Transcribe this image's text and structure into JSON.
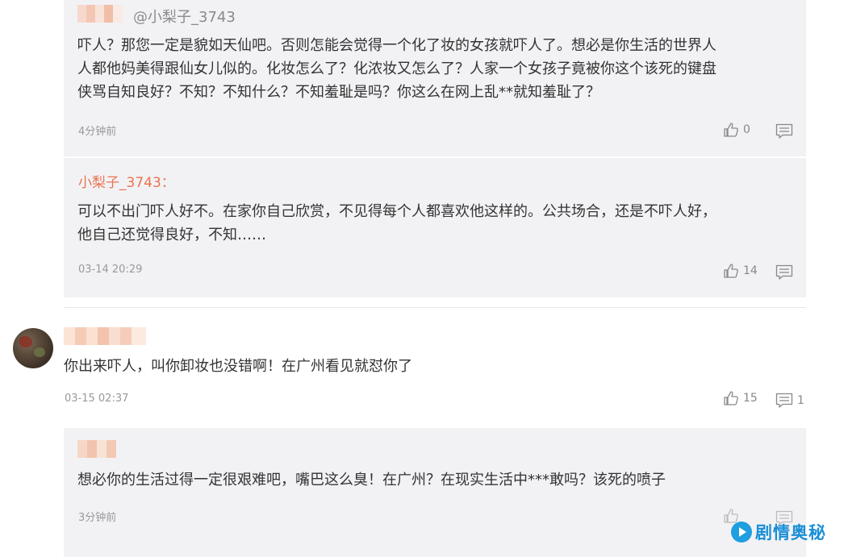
{
  "thread": {
    "replies_top": [
      {
        "handle": "@小梨子_3743",
        "text": "吓人？那您一定是貌如天仙吧。否则怎能会觉得一个化了妆的女孩就吓人了。想必是你生活的世界人\n人都他妈美得跟仙女儿似的。化妆怎么了？化浓妆又怎么了？人家一个女孩子竟被你这个该死的键盘\n侠骂自知良好？不知？不知什么？不知羞耻是吗？你这么在网上乱**就知羞耻了？",
        "time": "4分钟前",
        "likes": "0"
      },
      {
        "author": "小梨子_3743：",
        "text": "可以不出门吓人好不。在家你自己欣赏，不见得每个人都喜欢他这样的。公共场合，还是不吓人好，\n他自己还觉得良好，不知……",
        "time": "03-14 20:29",
        "likes": "14"
      }
    ],
    "comment": {
      "text": "你出来吓人，叫你卸妆也没错啊！在广州看见就怼你了",
      "time": "03-15 02:37",
      "likes": "15",
      "replies_count": "1"
    },
    "reply_bottom": {
      "text": "想必你的生活过得一定很艰难吧，嘴巴这么臭！在广州？在现实生活中***敢吗？该死的喷子",
      "time": "3分钟前"
    }
  },
  "watermark": {
    "text": "剧情奥秘"
  },
  "colors": {
    "reply_bg": "#f2f2f5",
    "author": "#eb7350",
    "muted": "#999999",
    "watermark": "#1a8fd6"
  },
  "icons": {
    "like": "thumbs-up-icon",
    "comment": "comment-icon",
    "logo": "play-logo-icon"
  }
}
